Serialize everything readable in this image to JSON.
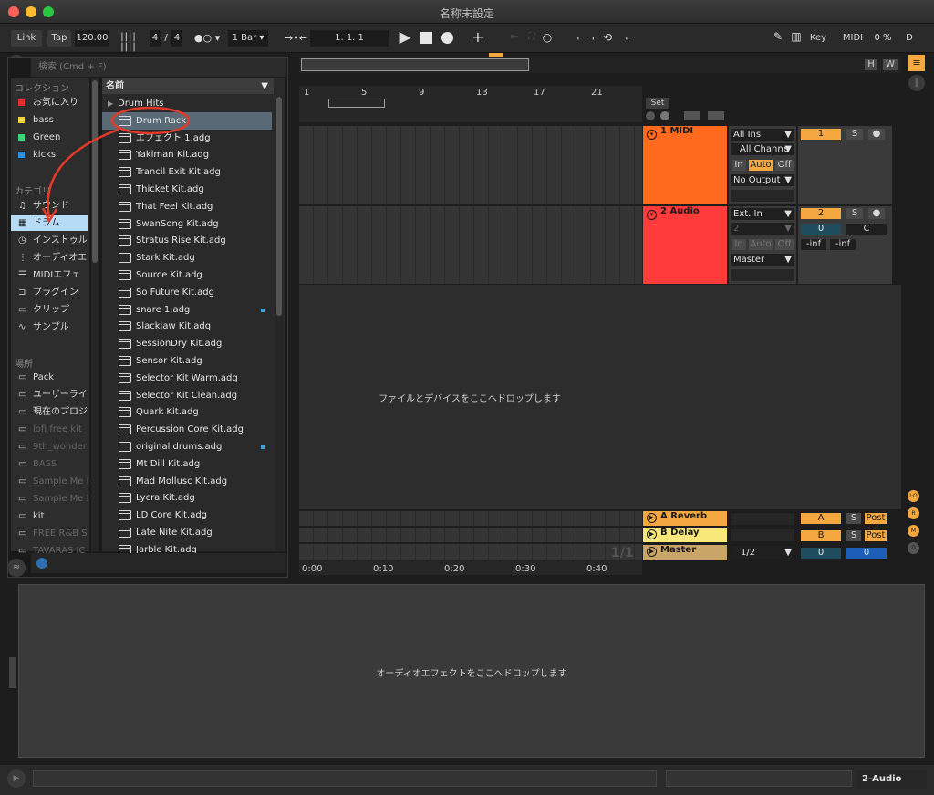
{
  "window": {
    "title": "名称未設定"
  },
  "control_bar": {
    "link": "Link",
    "tap": "Tap",
    "tempo": "120.00",
    "signature_num": "4",
    "signature_sep": "/",
    "signature_den": "4",
    "quantize": "1 Bar",
    "position": "1.   1.   1",
    "key": "Key",
    "midi": "MIDI",
    "cpu": "0 %",
    "d": "D"
  },
  "browser": {
    "search_placeholder": "検索 (Cmd + F)",
    "collections_head": "コレクション",
    "collections": [
      {
        "label": "お気に入り",
        "color": "#e0302a"
      },
      {
        "label": "bass",
        "color": "#f0d43a"
      },
      {
        "label": "Green",
        "color": "#3bd27a"
      },
      {
        "label": "kicks",
        "color": "#2d8fe0"
      }
    ],
    "categories_head": "カテゴリ",
    "categories": [
      {
        "label": "サウンド",
        "icon": "♫"
      },
      {
        "label": "ドラム",
        "icon": "▦"
      },
      {
        "label": "インストゥル",
        "icon": "◷"
      },
      {
        "label": "オーディオエ",
        "icon": "⋮"
      },
      {
        "label": "MIDIエフェ",
        "icon": "☰"
      },
      {
        "label": "プラグイン",
        "icon": "⊐"
      },
      {
        "label": "クリップ",
        "icon": "▭"
      },
      {
        "label": "サンプル",
        "icon": "∿"
      }
    ],
    "places_head": "場所",
    "places": [
      {
        "label": "Pack",
        "dim": false
      },
      {
        "label": "ユーザーライ",
        "dim": false
      },
      {
        "label": "現在のプロジ",
        "dim": false
      },
      {
        "label": "lofi free kit",
        "dim": true
      },
      {
        "label": "9th_wonder",
        "dim": true
      },
      {
        "label": "BASS",
        "dim": true
      },
      {
        "label": "Sample Me I",
        "dim": true
      },
      {
        "label": "Sample Me I",
        "dim": true
      },
      {
        "label": "kit",
        "dim": false
      },
      {
        "label": "FREE R&B S",
        "dim": true
      },
      {
        "label": "TAVARAS JC",
        "dim": true
      }
    ],
    "name_header": "名前",
    "files": [
      {
        "label": "Drum Hits",
        "folder": true
      },
      {
        "label": "Drum Rack",
        "selected": true
      },
      {
        "label": "エフェクト 1.adg"
      },
      {
        "label": "Yakiman Kit.adg"
      },
      {
        "label": "Trancil Exit Kit.adg"
      },
      {
        "label": "Thicket Kit.adg"
      },
      {
        "label": "That Feel Kit.adg"
      },
      {
        "label": "SwanSong Kit.adg"
      },
      {
        "label": "Stratus Rise Kit.adg"
      },
      {
        "label": "Stark Kit.adg"
      },
      {
        "label": "Source Kit.adg"
      },
      {
        "label": "So Future Kit.adg"
      },
      {
        "label": "snare 1.adg",
        "dot": true
      },
      {
        "label": "Slackjaw Kit.adg"
      },
      {
        "label": "SessionDry Kit.adg"
      },
      {
        "label": "Sensor Kit.adg"
      },
      {
        "label": "Selector Kit Warm.adg"
      },
      {
        "label": "Selector Kit Clean.adg"
      },
      {
        "label": "Quark Kit.adg"
      },
      {
        "label": "Percussion Core Kit.adg"
      },
      {
        "label": "original drums.adg",
        "dot": true
      },
      {
        "label": "Mt Dill Kit.adg"
      },
      {
        "label": "Mad Mollusc Kit.adg"
      },
      {
        "label": "Lycra Kit.adg"
      },
      {
        "label": "LD Core Kit.adg"
      },
      {
        "label": "Late Nite Kit.adg"
      },
      {
        "label": "Jarble Kit.adg"
      }
    ]
  },
  "session": {
    "overview_h": "H",
    "overview_w": "W",
    "bars": [
      "1",
      "5",
      "9",
      "13",
      "17",
      "21"
    ],
    "set_label": "Set",
    "drop_files": "ファイルとデバイスをここへドロップします",
    "page_indicator": "1/1",
    "times": [
      "0:00",
      "0:10",
      "0:20",
      "0:30",
      "0:40"
    ],
    "tracks": [
      {
        "name": "1 MIDI",
        "input": "All Ins",
        "channel": "All Channe",
        "output": "No Output",
        "number": "1",
        "color": "#ff6a1f",
        "monitor": [
          "In",
          "Auto",
          "Off"
        ],
        "solo": "S"
      },
      {
        "name": "2 Audio",
        "input": "Ext. In",
        "channel": "2",
        "output": "Master",
        "number": "2",
        "color": "#ff3b3b",
        "monitor": [
          "In",
          "Auto",
          "Off"
        ],
        "solo": "S",
        "send_val": "0",
        "pan": "C",
        "vol_l": "-inf",
        "vol_r": "-inf"
      }
    ],
    "returns": [
      {
        "name": "A Reverb",
        "letter": "A",
        "post": "Post",
        "solo": "S"
      },
      {
        "name": "B Delay",
        "letter": "B",
        "post": "Post",
        "solo": "S"
      }
    ],
    "master": {
      "name": "Master",
      "quant": "1/2",
      "val_a": "0",
      "val_b": "0"
    },
    "side_buttons": [
      "I·O",
      "R",
      "M",
      "D"
    ]
  },
  "detail": {
    "drop_effects": "オーディオエフェクトをここへドロップします"
  },
  "statusbar": {
    "track_label": "2-Audio"
  },
  "colors": {
    "accent": "#f5a740",
    "selection": "#b6dcf5",
    "annotation": "#e33a2a"
  }
}
